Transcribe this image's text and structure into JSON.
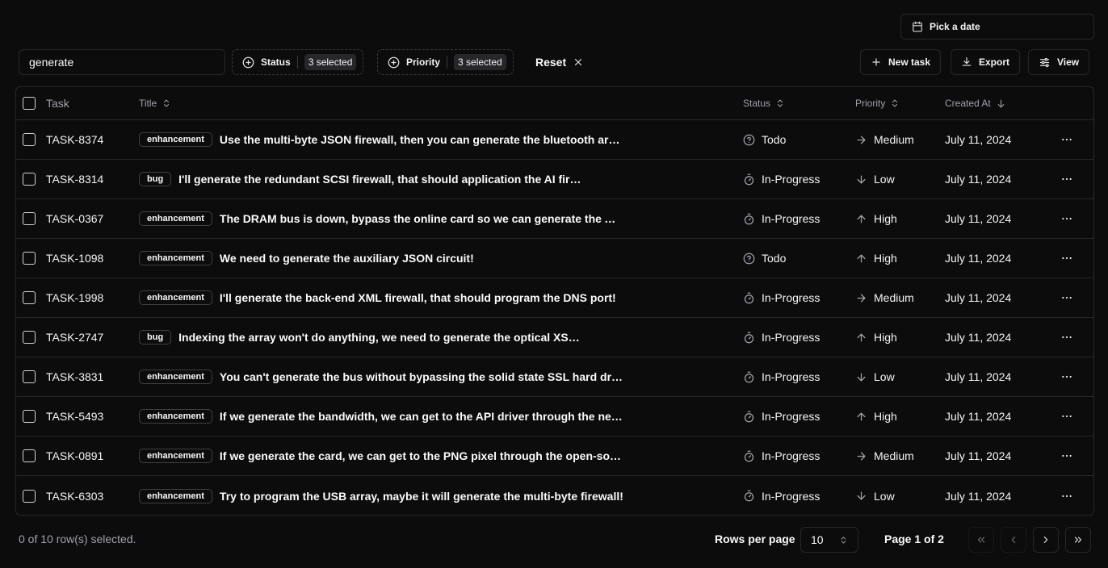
{
  "toolbar": {
    "date_picker_label": "Pick a date",
    "search_value": "generate",
    "status_filter": {
      "label": "Status",
      "badge": "3 selected"
    },
    "priority_filter": {
      "label": "Priority",
      "badge": "3 selected"
    },
    "reset_label": "Reset",
    "new_task_label": "New task",
    "export_label": "Export",
    "view_label": "View"
  },
  "table": {
    "columns": {
      "task": "Task",
      "title": "Title",
      "status": "Status",
      "priority": "Priority",
      "created_at": "Created At"
    },
    "rows": [
      {
        "id": "TASK-8374",
        "label": "enhancement",
        "title": "Use the multi-byte JSON firewall, then you can generate the bluetooth arr…",
        "status": "Todo",
        "priority": "Medium",
        "created": "July 11, 2024"
      },
      {
        "id": "TASK-8314",
        "label": "bug",
        "title": "I'll generate the redundant SCSI firewall, that should application the AI fire…",
        "status": "In-Progress",
        "priority": "Low",
        "created": "July 11, 2024"
      },
      {
        "id": "TASK-0367",
        "label": "enhancement",
        "title": "The DRAM bus is down, bypass the online card so we can generate the API…",
        "status": "In-Progress",
        "priority": "High",
        "created": "July 11, 2024"
      },
      {
        "id": "TASK-1098",
        "label": "enhancement",
        "title": "We need to generate the auxiliary JSON circuit!",
        "status": "Todo",
        "priority": "High",
        "created": "July 11, 2024"
      },
      {
        "id": "TASK-1998",
        "label": "enhancement",
        "title": "I'll generate the back-end XML firewall, that should program the DNS port!",
        "status": "In-Progress",
        "priority": "Medium",
        "created": "July 11, 2024"
      },
      {
        "id": "TASK-2747",
        "label": "bug",
        "title": "Indexing the array won't do anything, we need to generate the optical XSS …",
        "status": "In-Progress",
        "priority": "High",
        "created": "July 11, 2024"
      },
      {
        "id": "TASK-3831",
        "label": "enhancement",
        "title": "You can't generate the bus without bypassing the solid state SSL hard driv…",
        "status": "In-Progress",
        "priority": "Low",
        "created": "July 11, 2024"
      },
      {
        "id": "TASK-5493",
        "label": "enhancement",
        "title": "If we generate the bandwidth, we can get to the API driver through the ne…",
        "status": "In-Progress",
        "priority": "High",
        "created": "July 11, 2024"
      },
      {
        "id": "TASK-0891",
        "label": "enhancement",
        "title": "If we generate the card, we can get to the PNG pixel through the open-sou…",
        "status": "In-Progress",
        "priority": "Medium",
        "created": "July 11, 2024"
      },
      {
        "id": "TASK-6303",
        "label": "enhancement",
        "title": "Try to program the USB array, maybe it will generate the multi-byte firewall!",
        "status": "In-Progress",
        "priority": "Low",
        "created": "July 11, 2024"
      }
    ]
  },
  "footer": {
    "selection_text": "0 of 10 row(s) selected.",
    "rows_per_page_label": "Rows per page",
    "rows_per_page_value": "10",
    "page_label": "Page 1 of 2"
  },
  "icons": {
    "status": {
      "Todo": "circle-help-icon",
      "In-Progress": "timer-icon"
    },
    "priority": {
      "Low": "arrow-down-icon",
      "Medium": "arrow-right-icon",
      "High": "arrow-up-icon"
    }
  },
  "colors": {
    "background": "#0c0c0d",
    "border": "#27272a",
    "muted_text": "#a1a1aa",
    "text": "#fafafa"
  }
}
